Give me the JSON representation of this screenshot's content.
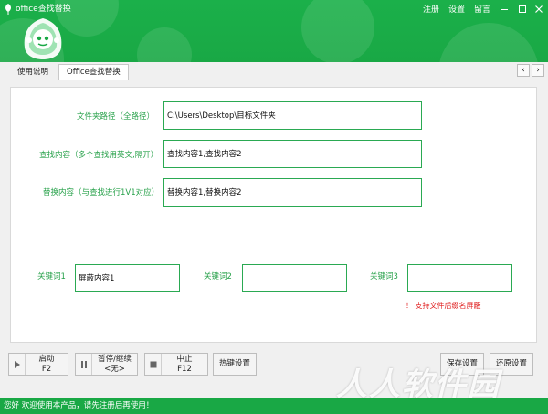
{
  "window": {
    "title": "office查找替换",
    "links": [
      "注册",
      "设置",
      "留言"
    ]
  },
  "tabs": [
    "使用说明",
    "Office查找替换"
  ],
  "form": {
    "folder_label": "文件夹路径（全路径）",
    "folder_value": "C:\\Users\\Desktop\\目标文件夹",
    "find_label": "查找内容（多个查找用英文,隔开）",
    "find_value": "查找内容1,查找内容2",
    "replace_label": "替换内容（与查找进行1V1对应）",
    "replace_value": "替换内容1,替换内容2",
    "keyword1_label": "关键词1",
    "keyword1_value": "屏蔽内容1",
    "keyword2_label": "关键词2",
    "keyword2_value": "",
    "keyword3_label": "关键词3",
    "keyword3_value": "",
    "note": "！ 支持文件后缀名屏蔽"
  },
  "toolbar": {
    "start": [
      "启动",
      "F2"
    ],
    "pause": [
      "暂停/继续",
      "<无>"
    ],
    "stop": [
      "中止",
      "F12"
    ],
    "hotkey": "热键设置",
    "save": "保存设置",
    "restore": "还原设置"
  },
  "status": "您好 欢迎使用本产品，请先注册后再使用！",
  "watermark": "人人软件园",
  "colors": {
    "brand_green": "#19a845",
    "label_green": "#27a14a",
    "warning_red": "#e02020"
  },
  "icons": {
    "app": "leaf-icon",
    "logo": "robot-mascot-logo",
    "start": "play-icon",
    "pause": "pause-icon",
    "stop": "stop-icon"
  }
}
